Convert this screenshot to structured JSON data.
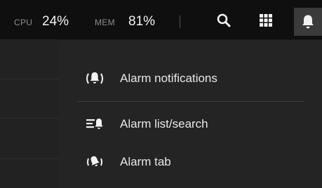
{
  "topbar": {
    "cpu_label": "CPU",
    "cpu_value": "24%",
    "mem_label": "MEM",
    "mem_value": "81%",
    "icons": [
      "search-icon",
      "apps-grid-icon",
      "bell-icon"
    ]
  },
  "alarm_menu": {
    "items": [
      {
        "label": "Alarm notifications",
        "icon": "ringing-bell-icon"
      },
      {
        "label": "Alarm list/search",
        "icon": "bell-list-icon"
      },
      {
        "label": "Alarm tab",
        "icon": "bell-tab-icon"
      }
    ]
  },
  "colors": {
    "topbar_bg": "#0f0f0f",
    "menu_bg": "#242424",
    "text": "#e8e8e8",
    "muted_label": "#8c8c8c",
    "active_button_bg": "#3a3a3a"
  }
}
